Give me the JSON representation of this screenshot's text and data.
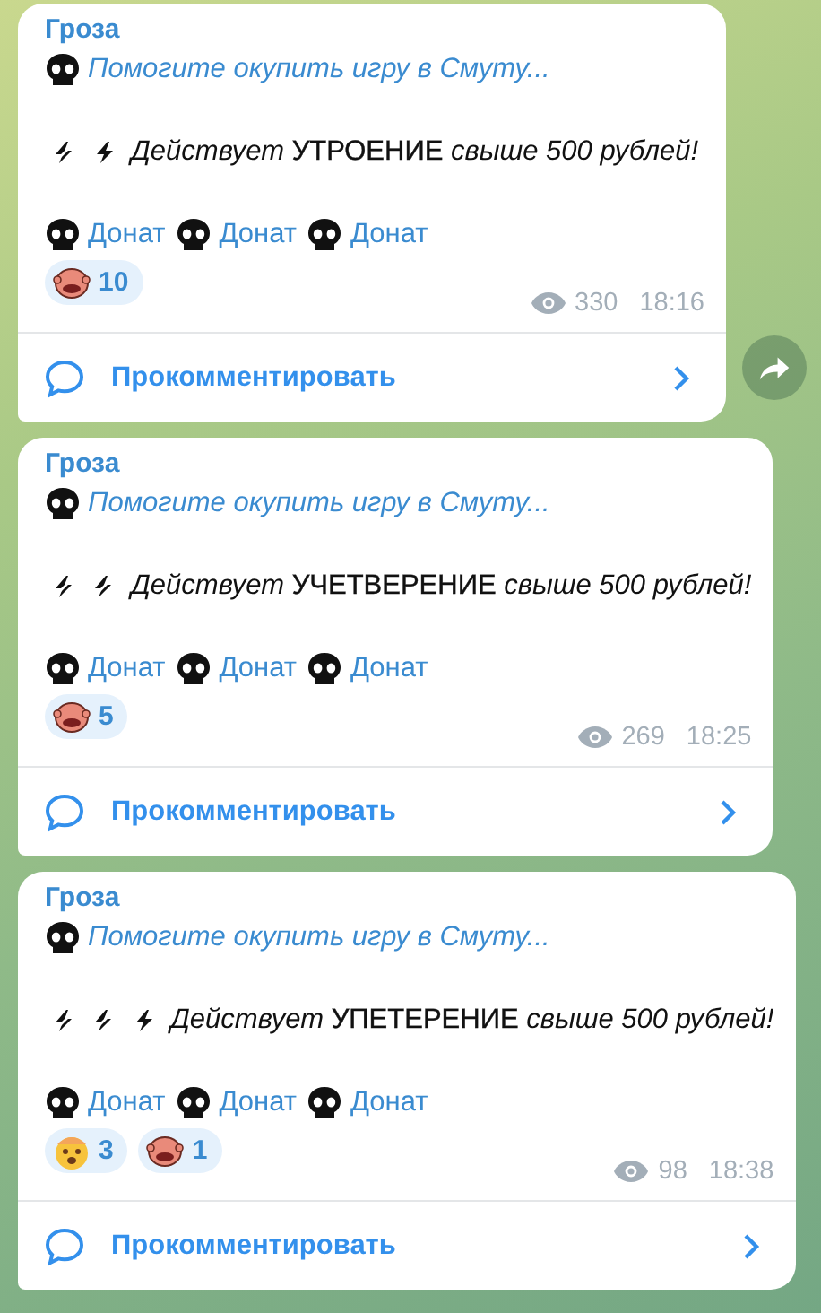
{
  "messages": [
    {
      "channel": "Гроза",
      "quote": "Помогите окупить игру в Смуту...",
      "promo_icons": [
        {
          "kind": "double"
        },
        {
          "kind": "single"
        }
      ],
      "promo_lead": "Действует",
      "promo_bold": "УТРОЕНИЕ",
      "promo_tail": "свыше 500 рублей!",
      "links": [
        "Донат",
        "Донат",
        "Донат"
      ],
      "reactions": [
        {
          "kind": "face",
          "count": "10"
        }
      ],
      "views": "330",
      "time": "18:16",
      "comment": "Прокомментировать",
      "share": true
    },
    {
      "channel": "Гроза",
      "quote": "Помогите окупить игру в Смуту...",
      "promo_icons": [
        {
          "kind": "double"
        },
        {
          "kind": "double"
        }
      ],
      "promo_lead": "Действует",
      "promo_bold": "УЧЕТВЕРЕНИЕ",
      "promo_tail": "свыше 500 рублей!",
      "links": [
        "Донат",
        "Донат",
        "Донат"
      ],
      "reactions": [
        {
          "kind": "face",
          "count": "5"
        }
      ],
      "views": "269",
      "time": "18:25",
      "comment": "Прокомментировать",
      "share": false
    },
    {
      "channel": "Гроза",
      "quote": "Помогите окупить игру в Смуту...",
      "promo_icons": [
        {
          "kind": "double"
        },
        {
          "kind": "double"
        },
        {
          "kind": "single"
        }
      ],
      "promo_lead": "Действует",
      "promo_bold": "УПЕТЕРЕНИЕ",
      "promo_tail": "свыше 500 рублей!",
      "links": [
        "Донат",
        "Донат",
        "Донат"
      ],
      "reactions": [
        {
          "kind": "shocked",
          "count": "3"
        },
        {
          "kind": "face",
          "count": "1"
        }
      ],
      "views": "98",
      "time": "18:38",
      "comment": "Прокомментировать",
      "share": false
    }
  ]
}
